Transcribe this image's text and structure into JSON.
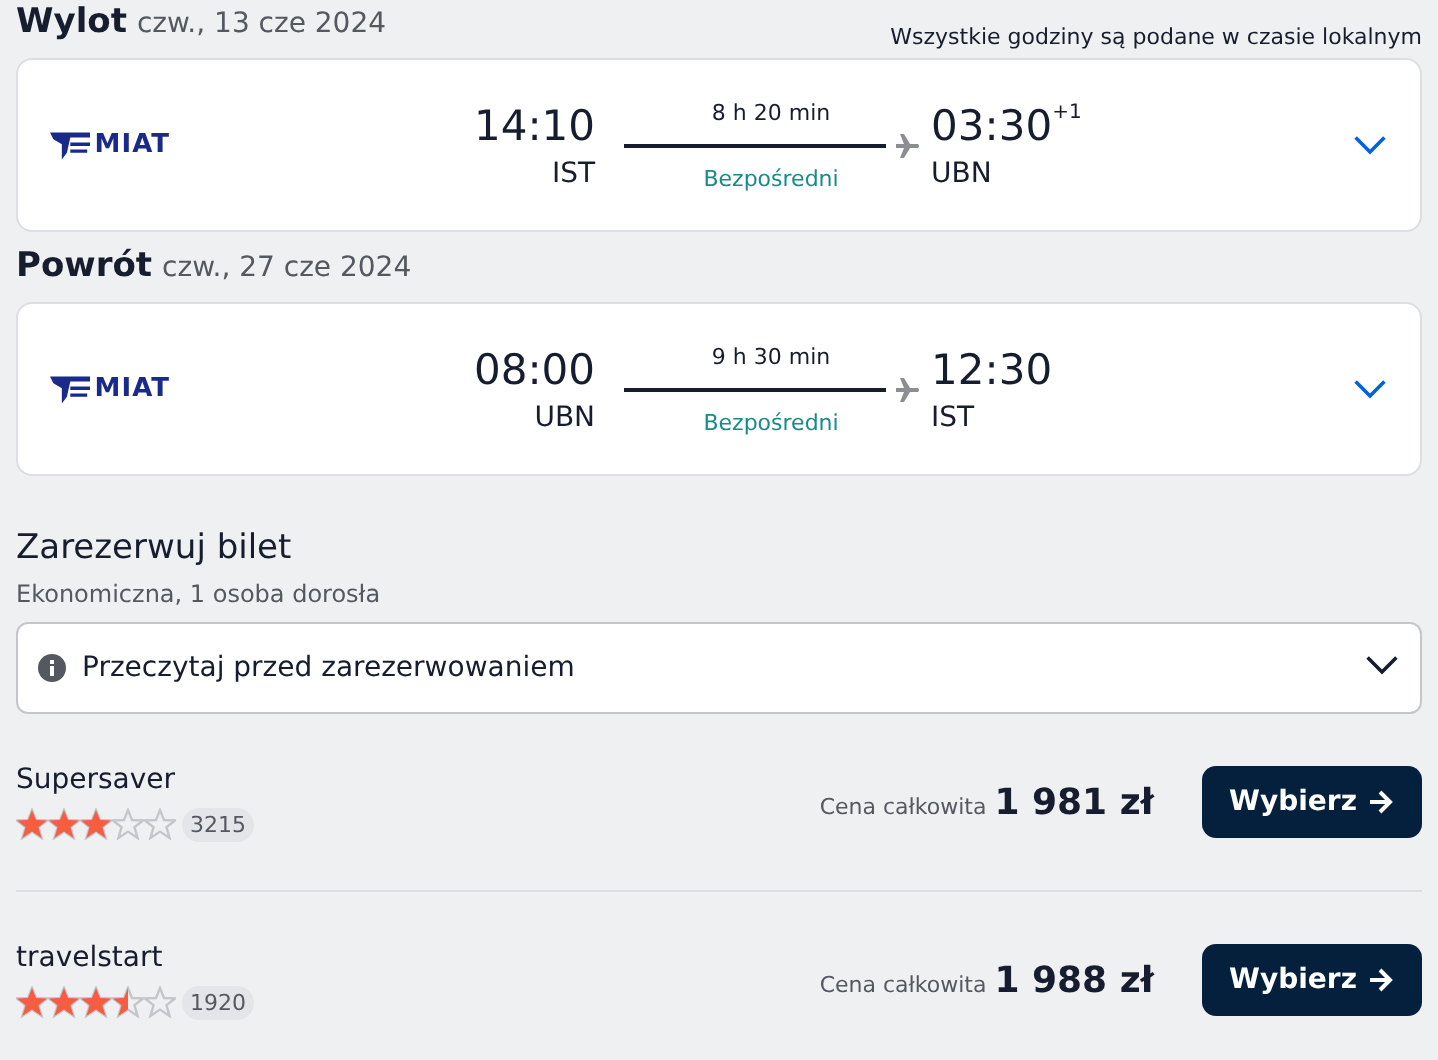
{
  "legs": [
    {
      "title": "Wylot",
      "date": "czw., 13 cze 2024",
      "note": "Wszystkie godziny są podane w czasie lokalnym",
      "airline_logo": "MIAT",
      "depart_time": "14:10",
      "depart_airport": "IST",
      "duration": "8 h 20 min",
      "stops": "Bezpośredni",
      "arrive_time": "03:30",
      "arrive_day_offset": "+1",
      "arrive_airport": "UBN",
      "expanded": false
    },
    {
      "title": "Powrót",
      "date": "czw., 27 cze 2024",
      "airline_logo": "MIAT",
      "depart_time": "08:00",
      "depart_airport": "UBN",
      "duration": "9 h 30 min",
      "stops": "Bezpośredni",
      "arrive_time": "12:30",
      "arrive_airport": "IST",
      "expanded": false
    }
  ],
  "booking": {
    "title": "Zarezerwuj bilet",
    "subtitle": "Ekonomiczna, 1 osoba dorosła",
    "notice": {
      "label": "Przeczytaj przed zarezerwowaniem",
      "expanded": false
    },
    "offers": [
      {
        "provider": "Supersaver",
        "stars": 3,
        "reviews": "3215",
        "price_label": "Cena całkowita",
        "price": "1 981 zł",
        "button": "Wybierz"
      },
      {
        "provider": "travelstart",
        "stars": 3.5,
        "reviews": "1920",
        "price_label": "Cena całkowita",
        "price": "1 988 zł",
        "button": "Wybierz"
      }
    ]
  }
}
